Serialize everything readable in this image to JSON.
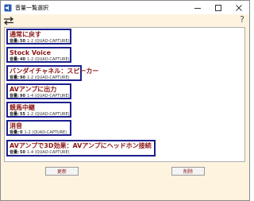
{
  "window": {
    "title": "音量一覧選択",
    "controls": {
      "minimize_icon": "minimize-icon",
      "maximize_icon": "maximize-icon",
      "close_icon": "close-icon"
    }
  },
  "toolbar": {
    "swap_icon": "swap-arrows-icon",
    "help_label": "?"
  },
  "presets": [
    {
      "name": "通常に戻す",
      "volume_label": "音量:",
      "volume": "50",
      "channel": "1-2 (QUAD-CAPTURE)"
    },
    {
      "name": "Stock Voice",
      "volume_label": "音量:",
      "volume": "40",
      "channel": "1-2 (QUAD-CAPTURE)"
    },
    {
      "name": "バンダイチャネル：スピーカー",
      "volume_label": "音量:",
      "volume": "90",
      "channel": "1-2 (QUAD-CAPTURE)"
    },
    {
      "name": "AVアンプに出力",
      "volume_label": "音量:",
      "volume": "90",
      "channel": "1-4 (QUAD-CAPTURE)"
    },
    {
      "name": "競馬中継",
      "volume_label": "音量:",
      "volume": "55",
      "channel": "1-2 (QUAD-CAPTURE)"
    },
    {
      "name": "消音",
      "volume_label": "音量:",
      "volume": "0",
      "channel": "1-2 (QUAD-CAPTURE)"
    },
    {
      "name": "AVアンプで3D効果：AVアンプにヘッドホン接続",
      "volume_label": "音量:",
      "volume": "50",
      "channel": "1-4 (QUAD-CAPTURE)"
    }
  ],
  "footer": {
    "update_label": "更新",
    "delete_label": "削除"
  },
  "colors": {
    "window_bg": "#fdf3df",
    "card_border": "#1c1f8c",
    "card_title": "#8b1414"
  }
}
